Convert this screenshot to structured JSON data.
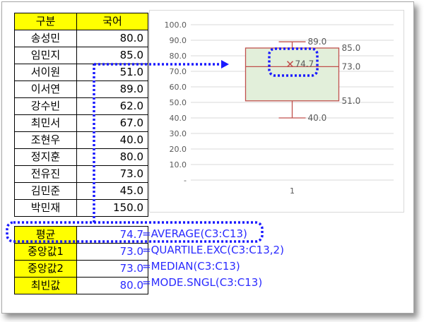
{
  "table": {
    "headers": [
      "구분",
      "국어"
    ],
    "rows": [
      {
        "name": "송성민",
        "score": "80.0"
      },
      {
        "name": "임민지",
        "score": "85.0"
      },
      {
        "name": "서이원",
        "score": "51.0"
      },
      {
        "name": "이서연",
        "score": "89.0"
      },
      {
        "name": "강수빈",
        "score": "62.0"
      },
      {
        "name": "최민서",
        "score": "67.0"
      },
      {
        "name": "조현우",
        "score": "40.0"
      },
      {
        "name": "정지훈",
        "score": "80.0"
      },
      {
        "name": "전유진",
        "score": "73.0"
      },
      {
        "name": "김민준",
        "score": "45.0"
      },
      {
        "name": "박민재",
        "score": "150.0"
      }
    ]
  },
  "stats": [
    {
      "label": "평균",
      "value": "74.7",
      "formula": "=AVERAGE(C3:C13)"
    },
    {
      "label": "중앙값1",
      "value": "73.0",
      "formula": "=QUARTILE.EXC(C3:C13,2)"
    },
    {
      "label": "중앙값2",
      "value": "73.0",
      "formula": "=MEDIAN(C3:C13)"
    },
    {
      "label": "최빈값",
      "value": "80.0",
      "formula": "=MODE.SNGL(C3:C13)"
    }
  ],
  "colors": {
    "header_fill": "#ffff00",
    "formula_text": "#2b2bff",
    "highlight_dots": "#1a1aff",
    "box_fill": "#e2efda",
    "box_stroke": "#c0504d",
    "axis_text": "#595959",
    "gridline": "#d9d9d9"
  },
  "chart_data": {
    "type": "box",
    "ylim": [
      0,
      100
    ],
    "ytick_values": [
      0,
      10,
      20,
      30,
      40,
      50,
      60,
      70,
      80,
      90,
      100
    ],
    "ytick_labels": [
      "-",
      "10.0",
      "20.0",
      "30.0",
      "40.0",
      "50.0",
      "60.0",
      "70.0",
      "80.0",
      "90.0",
      "100.0"
    ],
    "categories": [
      "1"
    ],
    "grid": true,
    "box": {
      "min": 40.0,
      "q1": 51.0,
      "median": 73.0,
      "q3": 85.0,
      "max": 89.0,
      "mean": 74.7
    },
    "labels": {
      "max": "89.0",
      "q3": "85.0",
      "mean": "74.7",
      "median": "73.0",
      "q1": "51.0",
      "min": "40.0"
    }
  }
}
